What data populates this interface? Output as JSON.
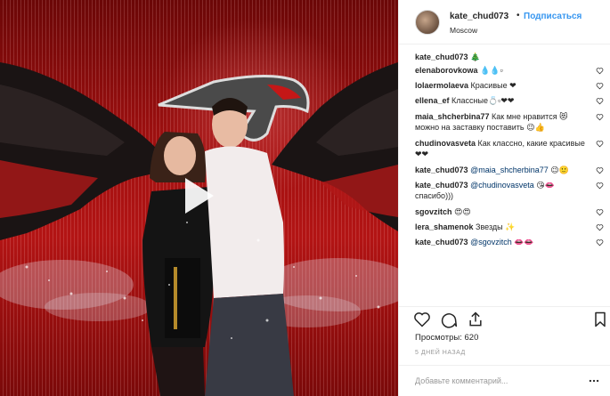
{
  "header": {
    "username": "kate_chud073",
    "dot": "•",
    "follow_label": "Подписаться",
    "location": "Moscow"
  },
  "comments": [
    {
      "user": "kate_chud073",
      "text": " 🎄",
      "liked": false,
      "parts": []
    },
    {
      "user": "elenaborovkowa",
      "text": " 💧💧▫",
      "liked": true,
      "parts": []
    },
    {
      "user": "lolaermolaeva",
      "text": " Красивые ❤",
      "liked": true,
      "parts": []
    },
    {
      "user": "ellena_ef",
      "text": " Классные💍▫❤❤",
      "liked": true,
      "parts": []
    },
    {
      "user": "maia_shcherbina77",
      "text": " Как мне нравится 😻 можно на заставку поставить 😉👍",
      "liked": true,
      "parts": []
    },
    {
      "user": "chudinovasveta",
      "text": " Как классно, какие красивые❤❤",
      "liked": true,
      "parts": []
    },
    {
      "user": "kate_chud073",
      "mention": "@maia_shcherbina77",
      "text": " 😉🙂",
      "liked": true
    },
    {
      "user": "kate_chud073",
      "mention": "@chudinovasveta",
      "text": " 😘👄 спасибо)))",
      "liked": true
    },
    {
      "user": "sgovzitch",
      "text": " 😍😍",
      "liked": true
    },
    {
      "user": "lera_shamenok",
      "text": " Звезды ✨",
      "liked": true
    },
    {
      "user": "kate_chud073",
      "mention": "@sgovzitch",
      "text": " 👄👄",
      "liked": true
    }
  ],
  "actions": {
    "like": "heart-icon",
    "comment": "comment-icon",
    "share": "share-icon",
    "save": "bookmark-icon"
  },
  "views": {
    "label": "Просмотры:",
    "count": "620"
  },
  "timestamp": "5 ДНЕЙ НАЗАД",
  "comment_box": {
    "placeholder": "Добавьте комментарий..."
  },
  "colors": {
    "link": "#3897f0",
    "mention": "#003569",
    "media_red": "#b31414"
  }
}
